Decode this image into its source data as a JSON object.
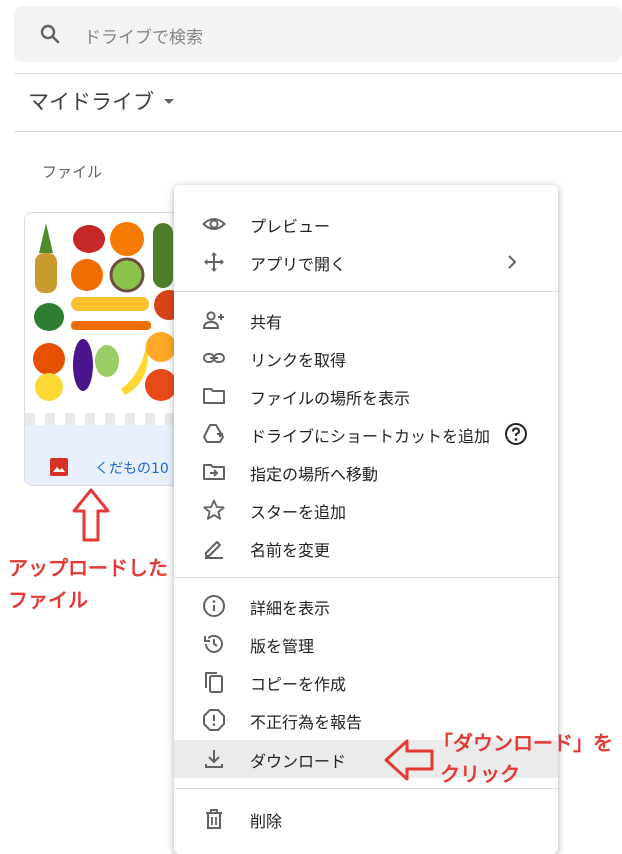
{
  "search": {
    "placeholder": "ドライブで検索"
  },
  "breadcrumb": {
    "title": "マイドライブ"
  },
  "section": {
    "label": "ファイル"
  },
  "file": {
    "name": "くだもの10"
  },
  "menu": {
    "items": [
      {
        "label": "プレビュー",
        "icon": "eye-icon"
      },
      {
        "label": "アプリで開く",
        "icon": "move-arrows-icon"
      },
      {
        "label": "共有",
        "icon": "person-add-icon"
      },
      {
        "label": "リンクを取得",
        "icon": "link-icon"
      },
      {
        "label": "ファイルの場所を表示",
        "icon": "folder-icon"
      },
      {
        "label": "ドライブにショートカットを追加",
        "icon": "shortcut-drive-icon"
      },
      {
        "label": "指定の場所へ移動",
        "icon": "move-to-folder-icon"
      },
      {
        "label": "スターを追加",
        "icon": "star-icon"
      },
      {
        "label": "名前を変更",
        "icon": "pencil-icon"
      },
      {
        "label": "詳細を表示",
        "icon": "info-icon"
      },
      {
        "label": "版を管理",
        "icon": "history-icon"
      },
      {
        "label": "コピーを作成",
        "icon": "copy-icon"
      },
      {
        "label": "不正行為を報告",
        "icon": "report-icon"
      },
      {
        "label": "ダウンロード",
        "icon": "download-icon"
      },
      {
        "label": "削除",
        "icon": "trash-icon"
      }
    ]
  },
  "annotations": {
    "uploaded_line1": "アップロードした",
    "uploaded_line2": "ファイル",
    "download_line1": "「ダウンロード」を",
    "download_line2": "クリック"
  },
  "colors": {
    "accent": "#1967d2",
    "annotation": "#e53935",
    "file_icon": "#d93025"
  }
}
